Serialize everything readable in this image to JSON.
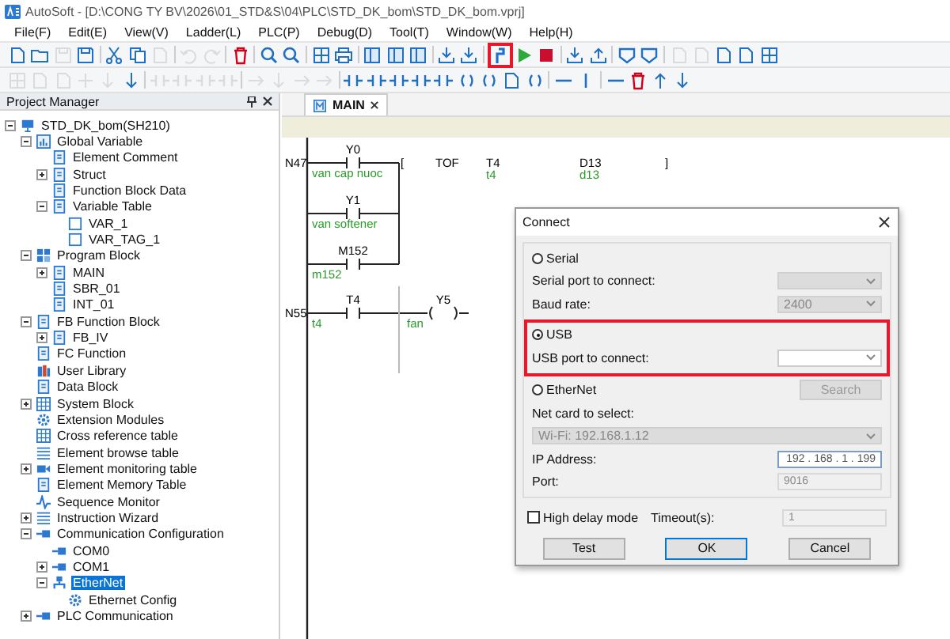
{
  "window": {
    "title": "AutoSoft - [D:\\CONG TY BV\\2026\\01_STD&S\\04\\PLC\\STD_DK_bom\\STD_DK_bom.vprj]"
  },
  "menu": [
    "File(F)",
    "Edit(E)",
    "View(V)",
    "Ladder(L)",
    "PLC(P)",
    "Debug(D)",
    "Tool(T)",
    "Window(W)",
    "Help(H)"
  ],
  "toolbars": [
    [
      {
        "kind": "file",
        "disabled": false
      },
      {
        "kind": "folder",
        "disabled": false
      },
      {
        "kind": "save",
        "disabled": true
      },
      {
        "kind": "save",
        "disabled": false
      },
      {
        "kind": "sep"
      },
      {
        "kind": "cut",
        "disabled": false
      },
      {
        "kind": "copy",
        "disabled": false
      },
      {
        "kind": "file",
        "disabled": true
      },
      {
        "kind": "sep"
      },
      {
        "kind": "undo",
        "disabled": true
      },
      {
        "kind": "redo",
        "disabled": true
      },
      {
        "kind": "sep"
      },
      {
        "kind": "trash",
        "disabled": false
      },
      {
        "kind": "sep"
      },
      {
        "kind": "search",
        "disabled": false
      },
      {
        "kind": "search",
        "disabled": false
      },
      {
        "kind": "sep"
      },
      {
        "kind": "grid",
        "disabled": false
      },
      {
        "kind": "print",
        "disabled": false
      },
      {
        "kind": "sep"
      },
      {
        "kind": "panel",
        "disabled": false
      },
      {
        "kind": "panel",
        "disabled": false
      },
      {
        "kind": "panel",
        "disabled": false
      },
      {
        "kind": "sep"
      },
      {
        "kind": "download",
        "disabled": false
      },
      {
        "kind": "download",
        "disabled": false
      },
      {
        "kind": "sep"
      },
      {
        "kind": "connect",
        "disabled": false,
        "highlighted": true
      },
      {
        "kind": "play",
        "disabled": false
      },
      {
        "kind": "stop",
        "disabled": false
      },
      {
        "kind": "sep"
      },
      {
        "kind": "download",
        "disabled": false
      },
      {
        "kind": "upload",
        "disabled": false
      },
      {
        "kind": "sep"
      },
      {
        "kind": "monitor",
        "disabled": false
      },
      {
        "kind": "monitor",
        "disabled": false
      },
      {
        "kind": "sep"
      },
      {
        "kind": "file",
        "disabled": true
      },
      {
        "kind": "file",
        "disabled": true
      },
      {
        "kind": "file",
        "disabled": false
      },
      {
        "kind": "file",
        "disabled": false
      },
      {
        "kind": "grid",
        "disabled": false
      }
    ],
    [
      {
        "kind": "grid",
        "disabled": true
      },
      {
        "kind": "file",
        "disabled": true
      },
      {
        "kind": "file",
        "disabled": true
      },
      {
        "kind": "cross",
        "disabled": true
      },
      {
        "kind": "down",
        "disabled": true
      },
      {
        "kind": "down",
        "disabled": false
      },
      {
        "kind": "sep"
      },
      {
        "kind": "contact",
        "disabled": true
      },
      {
        "kind": "contact",
        "disabled": true
      },
      {
        "kind": "contact",
        "disabled": true
      },
      {
        "kind": "contact",
        "disabled": true
      },
      {
        "kind": "sep"
      },
      {
        "kind": "right",
        "disabled": true
      },
      {
        "kind": "down",
        "disabled": true
      },
      {
        "kind": "right",
        "disabled": true
      },
      {
        "kind": "right",
        "disabled": true
      },
      {
        "kind": "sep"
      },
      {
        "kind": "contact",
        "disabled": false
      },
      {
        "kind": "contact",
        "disabled": false
      },
      {
        "kind": "contact",
        "disabled": false
      },
      {
        "kind": "contact",
        "disabled": false
      },
      {
        "kind": "contact",
        "disabled": false
      },
      {
        "kind": "coil",
        "disabled": false
      },
      {
        "kind": "coil",
        "disabled": false
      },
      {
        "kind": "file",
        "disabled": false
      },
      {
        "kind": "coil",
        "disabled": false
      },
      {
        "kind": "sep"
      },
      {
        "kind": "line",
        "disabled": false
      },
      {
        "kind": "vline",
        "disabled": false
      },
      {
        "kind": "sep"
      },
      {
        "kind": "line",
        "disabled": false
      },
      {
        "kind": "trash",
        "disabled": false
      },
      {
        "kind": "up",
        "disabled": false
      },
      {
        "kind": "down",
        "disabled": false
      }
    ]
  ],
  "project_manager": {
    "title": "Project Manager",
    "tree": [
      {
        "label": "STD_DK_bom(SH210)",
        "kind": "computer",
        "expanded": true,
        "selected": false,
        "children": [
          {
            "label": "Global Variable",
            "kind": "chart",
            "expanded": true,
            "selected": false,
            "children": [
              {
                "label": "Element Comment",
                "kind": "page",
                "selected": false
              },
              {
                "label": "Struct",
                "kind": "page",
                "expanded": false,
                "selected": false
              },
              {
                "label": "Function Block Data",
                "kind": "page",
                "selected": false
              },
              {
                "label": "Variable Table",
                "kind": "page",
                "expanded": true,
                "selected": false,
                "children": [
                  {
                    "label": "VAR_1",
                    "kind": "blank",
                    "selected": false
                  },
                  {
                    "label": "VAR_TAG_1",
                    "kind": "blank",
                    "selected": false
                  }
                ]
              }
            ]
          },
          {
            "label": "Program Block",
            "kind": "blocks",
            "expanded": true,
            "selected": false,
            "children": [
              {
                "label": "MAIN",
                "kind": "page",
                "expanded": false,
                "selected": false
              },
              {
                "label": "SBR_01",
                "kind": "page",
                "selected": false
              },
              {
                "label": "INT_01",
                "kind": "page",
                "selected": false
              }
            ]
          },
          {
            "label": "FB Function Block",
            "kind": "page",
            "expanded": true,
            "selected": false,
            "children": [
              {
                "label": "FB_IV",
                "kind": "page",
                "expanded": false,
                "selected": false
              }
            ]
          },
          {
            "label": "FC Function",
            "kind": "page",
            "selected": false
          },
          {
            "label": "User Library",
            "kind": "books",
            "selected": false
          },
          {
            "label": "Data Block",
            "kind": "page",
            "selected": false
          },
          {
            "label": "System Block",
            "kind": "grid",
            "expanded": false,
            "selected": false
          },
          {
            "label": "Extension Modules",
            "kind": "gear",
            "selected": false
          },
          {
            "label": "Cross reference table",
            "kind": "grid",
            "selected": false
          },
          {
            "label": "Element browse table",
            "kind": "list",
            "selected": false
          },
          {
            "label": "Element monitoring table",
            "kind": "camera",
            "expanded": false,
            "selected": false
          },
          {
            "label": "Element Memory Table",
            "kind": "page",
            "selected": false
          },
          {
            "label": "Sequence Monitor",
            "kind": "wave",
            "selected": false
          },
          {
            "label": "Instruction Wizard",
            "kind": "list",
            "expanded": false,
            "selected": false
          },
          {
            "label": "Communication Configuration",
            "kind": "plug",
            "expanded": true,
            "selected": false,
            "children": [
              {
                "label": "COM0",
                "kind": "plug",
                "selected": false
              },
              {
                "label": "COM1",
                "kind": "plug",
                "expanded": false,
                "selected": false
              },
              {
                "label": "EtherNet",
                "kind": "network",
                "expanded": true,
                "selected": true,
                "children": [
                  {
                    "label": "Ethernet Config",
                    "kind": "gear",
                    "selected": false
                  }
                ]
              }
            ]
          },
          {
            "label": "PLC Communication",
            "kind": "plug",
            "expanded": false,
            "selected": false
          }
        ]
      }
    ]
  },
  "editor_tabs": [
    {
      "label": "MAIN",
      "selected": true
    }
  ],
  "ladder": {
    "rungs": [
      {
        "step": "N47",
        "contacts": [
          {
            "address": "Y0",
            "comment": "van cap nuoc"
          },
          {
            "address": "Y1",
            "comment": "van softener"
          },
          {
            "address": "M152",
            "comment": "m152"
          }
        ],
        "instruction": {
          "open": "[",
          "name": "TOF",
          "operands": [
            {
              "address": "T4",
              "comment": "t4"
            },
            {
              "address": "D13",
              "comment": "d13"
            }
          ],
          "close": "]"
        }
      },
      {
        "step": "N55",
        "contacts": [
          {
            "address": "T4",
            "comment": "t4"
          }
        ],
        "coil": {
          "address": "Y5",
          "comment": "fan"
        }
      }
    ]
  },
  "connect_dialog": {
    "title": "Connect",
    "sections": [
      {
        "option": "Serial",
        "selected": false,
        "fields": [
          {
            "kind": "dropdown",
            "label": "Serial port to connect:",
            "disabled": true
          },
          {
            "kind": "dropdown",
            "label": "Baud rate:",
            "value": "2400",
            "disabled": true
          }
        ]
      },
      {
        "option": "USB",
        "selected": true,
        "highlighted": true,
        "fields": [
          {
            "kind": "dropdown",
            "label": "USB port to connect:",
            "disabled": false
          }
        ]
      },
      {
        "option": "EtherNet",
        "selected": false,
        "button": {
          "label": "Search",
          "disabled": true
        },
        "fields": [
          {
            "kind": "wide-dropdown",
            "label": "Net card to select:",
            "value": "Wi-Fi: 192.168.1.12",
            "disabled": true
          },
          {
            "kind": "input",
            "label": "IP Address:",
            "value": "192 . 168 .  1  . 199",
            "disabled": false
          },
          {
            "kind": "input",
            "label": "Port:",
            "value": "9016",
            "disabled": true
          }
        ]
      }
    ],
    "high_delay": {
      "label": "High delay mode",
      "checked": false
    },
    "timeout": {
      "label": "Timeout(s):",
      "value": "1",
      "disabled": true
    },
    "buttons": [
      {
        "label": "Test",
        "default": false
      },
      {
        "label": "OK",
        "default": true
      },
      {
        "label": "Cancel",
        "default": false
      }
    ]
  }
}
